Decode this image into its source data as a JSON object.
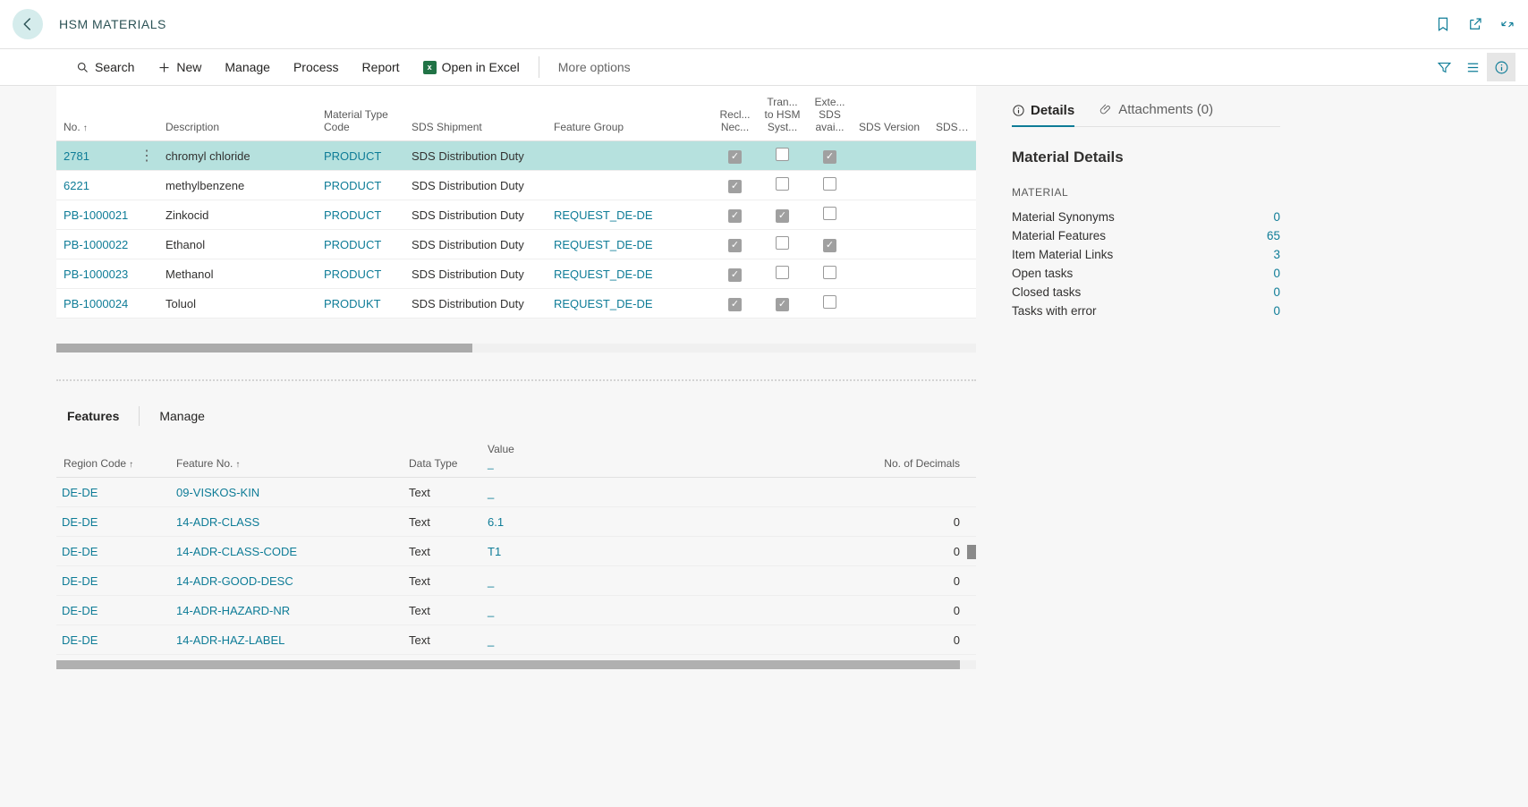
{
  "header": {
    "title": "HSM MATERIALS"
  },
  "toolbar": {
    "search": "Search",
    "new": "New",
    "manage": "Manage",
    "process": "Process",
    "report": "Report",
    "excel": "Open in Excel",
    "more": "More options"
  },
  "grid": {
    "columns": {
      "no": "No.",
      "description": "Description",
      "materialTypeCode": "Material Type Code",
      "sdsShipment": "SDS Shipment",
      "featureGroup": "Feature Group",
      "reclNec": "Recl... Nec...",
      "tranToHsm": "Tran... to HSM Syst...",
      "exteSds": "Exte... SDS avai...",
      "sdsVersion": "SDS Version",
      "sdsSubvers": "SDS Subvers"
    },
    "rows": [
      {
        "no": "2781",
        "desc": "chromyl chloride",
        "mtc": "PRODUCT",
        "sds": "SDS Distribution Duty",
        "fg": "",
        "cb1": true,
        "cb2": false,
        "cb3": true,
        "selected": true
      },
      {
        "no": "6221",
        "desc": "methylbenzene",
        "mtc": "PRODUCT",
        "sds": "SDS Distribution Duty",
        "fg": "",
        "cb1": true,
        "cb2": false,
        "cb3": false
      },
      {
        "no": "PB-1000021",
        "desc": "Zinkocid",
        "mtc": "PRODUCT",
        "sds": "SDS Distribution Duty",
        "fg": "REQUEST_DE-DE",
        "cb1": true,
        "cb2": true,
        "cb3": false
      },
      {
        "no": "PB-1000022",
        "desc": "Ethanol",
        "mtc": "PRODUCT",
        "sds": "SDS Distribution Duty",
        "fg": "REQUEST_DE-DE",
        "cb1": true,
        "cb2": false,
        "cb3": true
      },
      {
        "no": "PB-1000023",
        "desc": "Methanol",
        "mtc": "PRODUCT",
        "sds": "SDS Distribution Duty",
        "fg": "REQUEST_DE-DE",
        "cb1": true,
        "cb2": false,
        "cb3": false
      },
      {
        "no": "PB-1000024",
        "desc": "Toluol",
        "mtc": "PRODUKT",
        "sds": "SDS Distribution Duty",
        "fg": "REQUEST_DE-DE",
        "cb1": true,
        "cb2": true,
        "cb3": false
      }
    ]
  },
  "subtabs": {
    "features": "Features",
    "manage": "Manage"
  },
  "fgrid": {
    "columns": {
      "region": "Region Code",
      "featureNo": "Feature No.",
      "dataType": "Data Type",
      "value": "Value",
      "decimals": "No. of Decimals"
    },
    "rows": [
      {
        "region": "DE-DE",
        "fno": "09-VISKOS-KIN",
        "dt": "Text",
        "val": "_",
        "dec": ""
      },
      {
        "region": "DE-DE",
        "fno": "14-ADR-CLASS",
        "dt": "Text",
        "val": "6.1",
        "dec": "0"
      },
      {
        "region": "DE-DE",
        "fno": "14-ADR-CLASS-CODE",
        "dt": "Text",
        "val": "T1",
        "dec": "0"
      },
      {
        "region": "DE-DE",
        "fno": "14-ADR-GOOD-DESC",
        "dt": "Text",
        "val": "_",
        "dec": "0"
      },
      {
        "region": "DE-DE",
        "fno": "14-ADR-HAZARD-NR",
        "dt": "Text",
        "val": "_",
        "dec": "0"
      },
      {
        "region": "DE-DE",
        "fno": "14-ADR-HAZ-LABEL",
        "dt": "Text",
        "val": "_",
        "dec": "0"
      }
    ]
  },
  "factbox": {
    "detailsTab": "Details",
    "attachmentsTab": "Attachments (0)",
    "title": "Material Details",
    "section": "MATERIAL",
    "rows": [
      {
        "label": "Material Synonyms",
        "value": "0"
      },
      {
        "label": "Material Features",
        "value": "65"
      },
      {
        "label": "Item Material Links",
        "value": "3"
      },
      {
        "label": "Open tasks",
        "value": "0"
      },
      {
        "label": "Closed tasks",
        "value": "0"
      },
      {
        "label": "Tasks with error",
        "value": "0"
      }
    ]
  }
}
